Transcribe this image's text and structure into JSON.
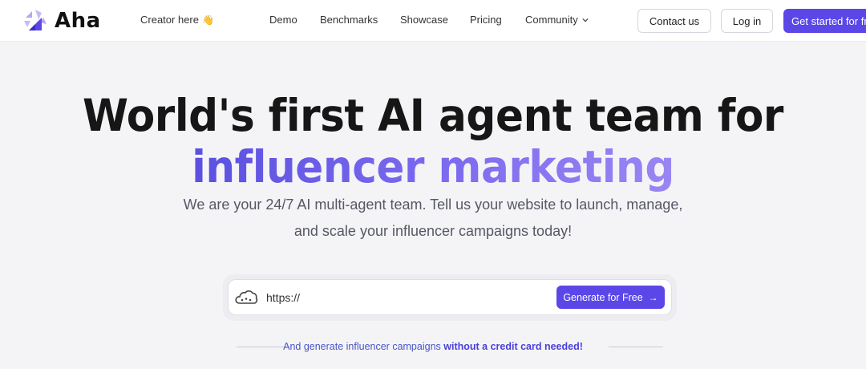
{
  "nav": {
    "logo_text": "Aha",
    "creator_label": "Creator here",
    "creator_emoji": "👋",
    "links": [
      "Demo",
      "Benchmarks",
      "Showcase",
      "Pricing",
      "Community"
    ],
    "contact_label": "Contact us",
    "login_label": "Log in",
    "get_started_label": "Get started for free"
  },
  "hero": {
    "headline_line1": "World's first AI agent team for",
    "headline_line2": "influencer marketing",
    "subtitle_line1": "We are your 24/7 AI multi-agent team. Tell us your website to launch, manage,",
    "subtitle_line2": "and scale your influencer campaigns today!"
  },
  "url_form": {
    "placeholder": "https://",
    "value": "",
    "generate_label": "Generate for Free",
    "generate_arrow": "→"
  },
  "footnote": {
    "prefix": "And generate influencer campaigns ",
    "emphasis": "without a credit card needed!"
  },
  "colors": {
    "brand": "#5b46e8",
    "accent_gradient_start": "#5a50e0",
    "accent_gradient_end": "#9a86f2",
    "background": "#f4f4f7"
  }
}
